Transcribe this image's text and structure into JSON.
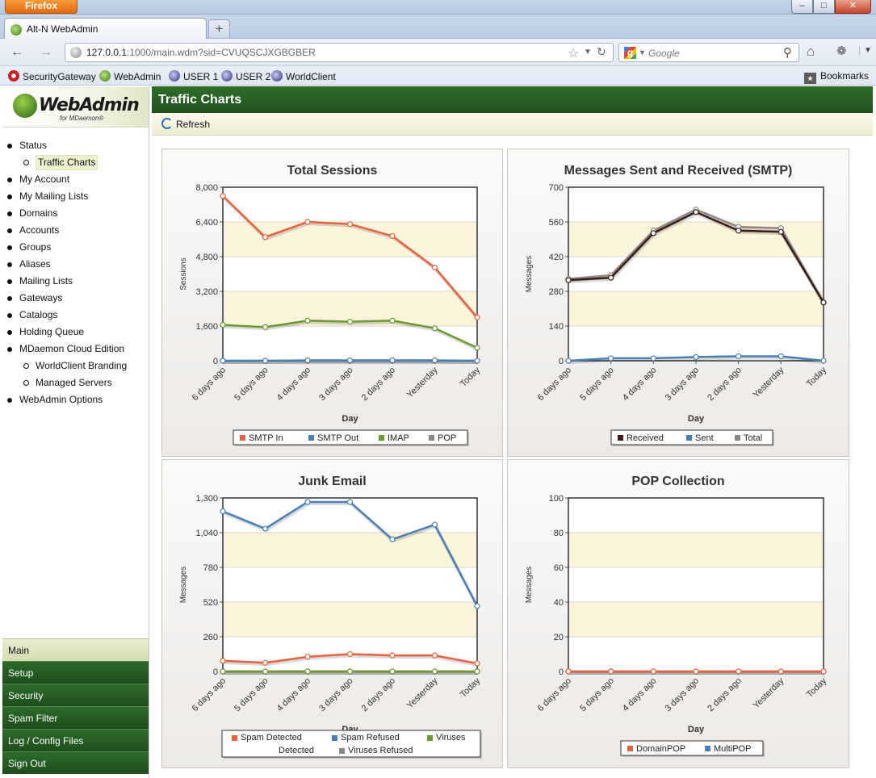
{
  "browser": {
    "app_button": "Firefox",
    "tab_title": "Alt-N WebAdmin",
    "url_host": "127.0.0.1",
    "url_rest": ":1000/main.wdm?sid=CVUQSCJXGBGBER",
    "search_engine": "Google",
    "bookmarks": [
      "SecurityGateway",
      "WebAdmin",
      "USER 1",
      "USER 2",
      "WorldClient"
    ],
    "bookmarks_menu": "Bookmarks"
  },
  "logo": {
    "name": "WebAdmin",
    "sub": "for MDaemon®"
  },
  "nav": {
    "items": [
      {
        "label": "Status",
        "level": 1
      },
      {
        "label": "Traffic Charts",
        "level": 2,
        "selected": true
      },
      {
        "label": "My Account",
        "level": 1
      },
      {
        "label": "My Mailing Lists",
        "level": 1
      },
      {
        "label": "Domains",
        "level": 1
      },
      {
        "label": "Accounts",
        "level": 1
      },
      {
        "label": "Groups",
        "level": 1
      },
      {
        "label": "Aliases",
        "level": 1
      },
      {
        "label": "Mailing Lists",
        "level": 1
      },
      {
        "label": "Gateways",
        "level": 1
      },
      {
        "label": "Catalogs",
        "level": 1
      },
      {
        "label": "Holding Queue",
        "level": 1
      },
      {
        "label": "MDaemon Cloud Edition",
        "level": 1
      },
      {
        "label": "WorldClient Branding",
        "level": 2
      },
      {
        "label": "Managed Servers",
        "level": 2
      },
      {
        "label": "WebAdmin Options",
        "level": 1
      }
    ],
    "bottom": [
      {
        "label": "Main",
        "active": true
      },
      {
        "label": "Setup"
      },
      {
        "label": "Security"
      },
      {
        "label": "Spam Filter"
      },
      {
        "label": "Log / Config Files"
      },
      {
        "label": "Sign Out"
      }
    ]
  },
  "page": {
    "title": "Traffic Charts",
    "refresh_label": "Refresh"
  },
  "colors": {
    "band": "#fdf4dc",
    "orange": "#e8603c",
    "blue": "#4a7fb5",
    "green": "#6a9a32",
    "gray": "#8c8684",
    "dark": "#3a1f1a"
  },
  "chart_data": [
    {
      "type": "line",
      "title": "Total Sessions",
      "xlabel": "Day",
      "ylabel": "Sessions",
      "categories": [
        "6 days ago",
        "5 days ago",
        "4 days ago",
        "3 days ago",
        "2 days ago",
        "Yesterday",
        "Today"
      ],
      "ylim": [
        0,
        8000
      ],
      "yticks": [
        "0",
        "1,600",
        "3,200",
        "4,800",
        "6,400",
        "8,000"
      ],
      "series": [
        {
          "name": "SMTP In",
          "color": "#e8603c",
          "values": [
            7600,
            5700,
            6400,
            6300,
            5750,
            4300,
            2000
          ]
        },
        {
          "name": "SMTP Out",
          "color": "#4a7fb5",
          "values": [
            0,
            0,
            20,
            20,
            20,
            20,
            0
          ]
        },
        {
          "name": "IMAP",
          "color": "#6a9a32",
          "values": [
            1650,
            1550,
            1850,
            1800,
            1850,
            1500,
            600
          ]
        },
        {
          "name": "POP",
          "color": "#8c8684",
          "values": [
            0,
            0,
            0,
            0,
            0,
            0,
            0
          ]
        }
      ],
      "legend": "bottom"
    },
    {
      "type": "line",
      "title": "Messages Sent and Received (SMTP)",
      "xlabel": "Day",
      "ylabel": "Messages",
      "categories": [
        "6 days ago",
        "5 days ago",
        "4 days ago",
        "3 days ago",
        "2 days ago",
        "Yesterday",
        "Today"
      ],
      "ylim": [
        0,
        700
      ],
      "yticks": [
        "0",
        "140",
        "280",
        "420",
        "560",
        "700"
      ],
      "series": [
        {
          "name": "Received",
          "color": "#3a1f1a",
          "values": [
            325,
            335,
            515,
            600,
            525,
            520,
            235
          ]
        },
        {
          "name": "Sent",
          "color": "#4a7fb5",
          "values": [
            0,
            10,
            10,
            15,
            18,
            18,
            0
          ]
        },
        {
          "name": "Total",
          "color": "#8c8684",
          "values": [
            330,
            345,
            525,
            610,
            540,
            535,
            235
          ]
        }
      ],
      "legend": "bottom"
    },
    {
      "type": "line",
      "title": "Junk Email",
      "xlabel": "Day",
      "ylabel": "Messages",
      "categories": [
        "6 days ago",
        "5 days ago",
        "4 days ago",
        "3 days ago",
        "2 days ago",
        "Yesterday",
        "Today"
      ],
      "ylim": [
        0,
        1300
      ],
      "yticks": [
        "0",
        "260",
        "520",
        "780",
        "1,040",
        "1,300"
      ],
      "series": [
        {
          "name": "Spam Detected",
          "color": "#e8603c",
          "values": [
            80,
            65,
            110,
            130,
            120,
            120,
            60
          ]
        },
        {
          "name": "Spam Refused",
          "color": "#4a7fb5",
          "values": [
            1200,
            1070,
            1270,
            1270,
            990,
            1100,
            490
          ]
        },
        {
          "name": "Viruses Detected",
          "color": "#6a9a32",
          "values": [
            0,
            0,
            0,
            0,
            0,
            0,
            0
          ]
        },
        {
          "name": "Viruses Refused",
          "color": "#8c8684",
          "values": [
            0,
            0,
            0,
            0,
            0,
            0,
            0
          ]
        }
      ],
      "legend": "bottom"
    },
    {
      "type": "line",
      "title": "POP Collection",
      "xlabel": "Day",
      "ylabel": "Messages",
      "categories": [
        "6 days ago",
        "5 days ago",
        "4 days ago",
        "3 days ago",
        "2 days ago",
        "Yesterday",
        "Today"
      ],
      "ylim": [
        0,
        100
      ],
      "yticks": [
        "0",
        "20",
        "40",
        "60",
        "80",
        "100"
      ],
      "series": [
        {
          "name": "DomainPOP",
          "color": "#e8603c",
          "values": [
            0,
            0,
            0,
            0,
            0,
            0,
            0
          ]
        },
        {
          "name": "MultiPOP",
          "color": "#4a7fb5",
          "values": [
            0,
            0,
            0,
            0,
            0,
            0,
            0
          ]
        }
      ],
      "legend": "bottom"
    }
  ]
}
